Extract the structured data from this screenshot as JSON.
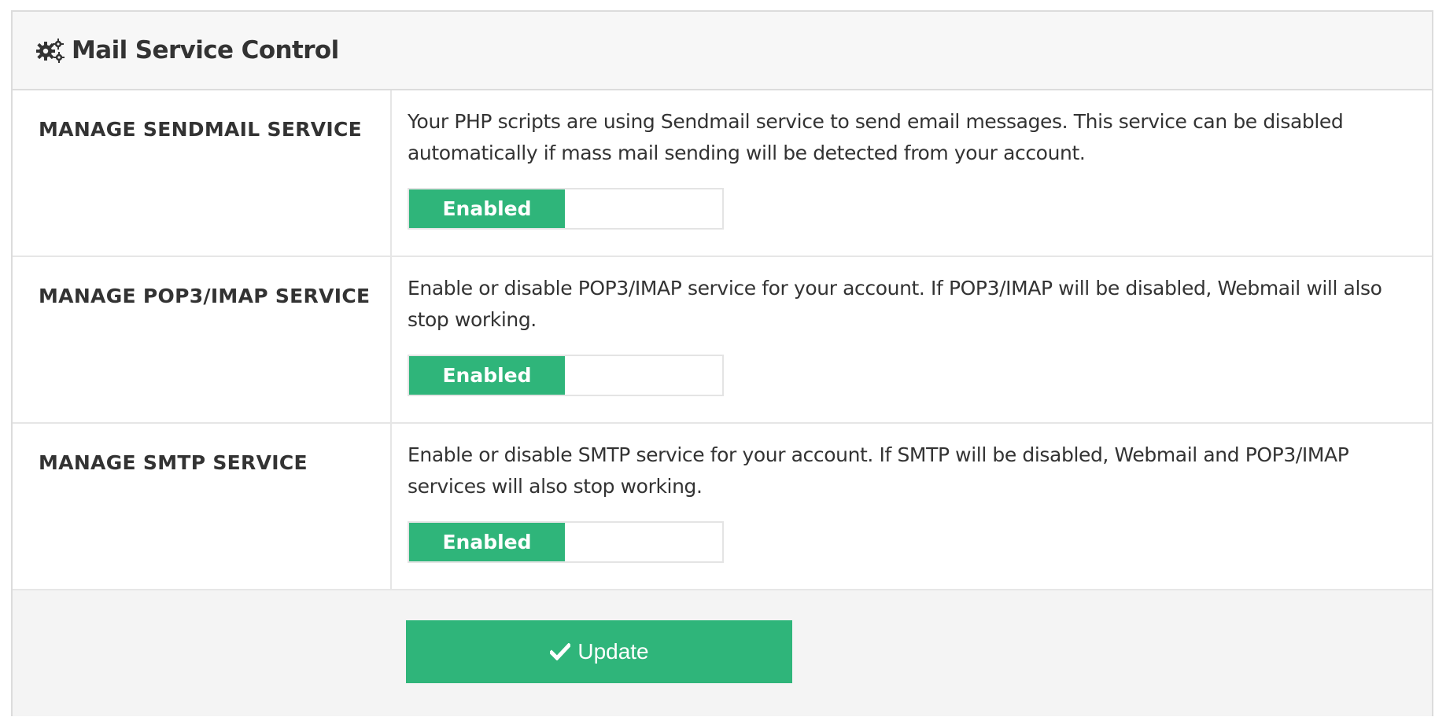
{
  "panel": {
    "title": "Mail Service Control",
    "icon": "gears-icon"
  },
  "services": [
    {
      "label": "MANAGE SENDMAIL SERVICE",
      "description": "Your PHP scripts are using Sendmail service to send email messages. This service can be disabled automatically if mass mail sending will be detected from your account.",
      "toggle_state": "Enabled"
    },
    {
      "label": "MANAGE POP3/IMAP SERVICE",
      "description": "Enable or disable POP3/IMAP service for your account. If POP3/IMAP will be disabled, Webmail will also stop working.",
      "toggle_state": "Enabled"
    },
    {
      "label": "MANAGE SMTP SERVICE",
      "description": "Enable or disable SMTP service for your account. If SMTP will be disabled, Webmail and POP3/IMAP services will also stop working.",
      "toggle_state": "Enabled"
    }
  ],
  "footer": {
    "update_label": "Update",
    "update_icon": "check-icon"
  },
  "colors": {
    "accent": "#2fb57a",
    "header_bg": "#f7f7f7",
    "footer_bg": "#f4f4f4",
    "border": "#dcdcdc",
    "text": "#333333"
  }
}
